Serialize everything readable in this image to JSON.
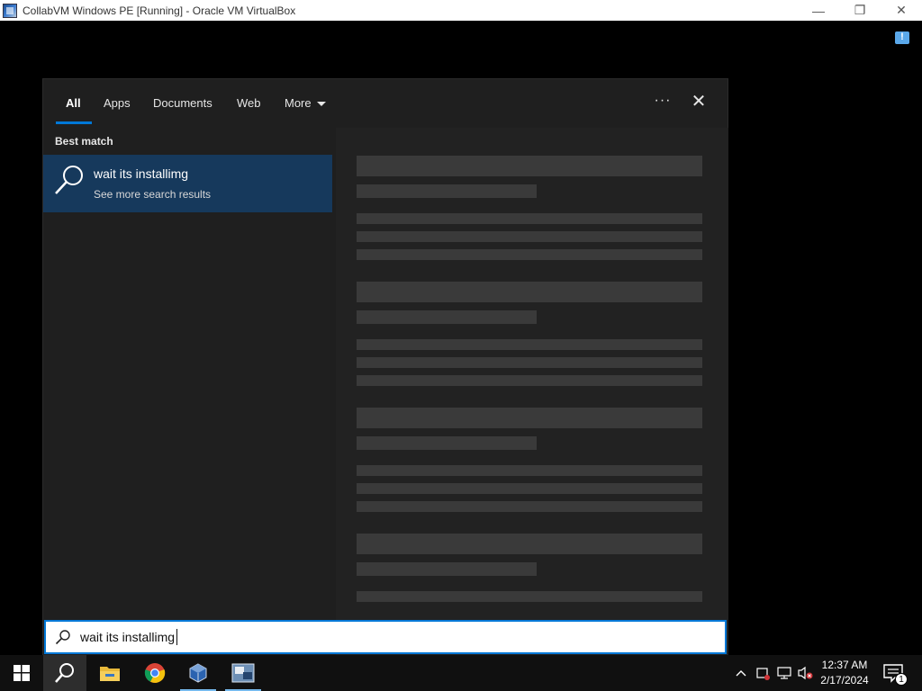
{
  "host_window": {
    "title": "CollabVM Windows PE [Running] - Oracle VM VirtualBox",
    "controls": {
      "minimize": "—",
      "restore": "❐",
      "close": "✕"
    }
  },
  "search_panel": {
    "tabs": [
      {
        "label": "All",
        "active": true
      },
      {
        "label": "Apps",
        "active": false
      },
      {
        "label": "Documents",
        "active": false
      },
      {
        "label": "Web",
        "active": false
      },
      {
        "label": "More",
        "active": false
      }
    ],
    "ellipsis": "···",
    "close": "✕",
    "section_label": "Best match",
    "best_match": {
      "title": "wait its installimg",
      "subtitle": "See more search results"
    }
  },
  "search_box": {
    "value": "wait its installimg",
    "icon": "search-icon"
  },
  "taskbar": {
    "apps": [
      "start-icon",
      "search-icon",
      "file-explorer-icon",
      "chrome-icon",
      "virtualbox-icon",
      "wine-app-icon"
    ],
    "tray": {
      "clock_time": "12:37 AM",
      "clock_date": "2/17/2024",
      "notification_count": "1"
    }
  },
  "colors": {
    "accent": "#0078d7",
    "selection": "#16395c",
    "panel": "#1f1f1f",
    "taskbar": "#101010"
  }
}
